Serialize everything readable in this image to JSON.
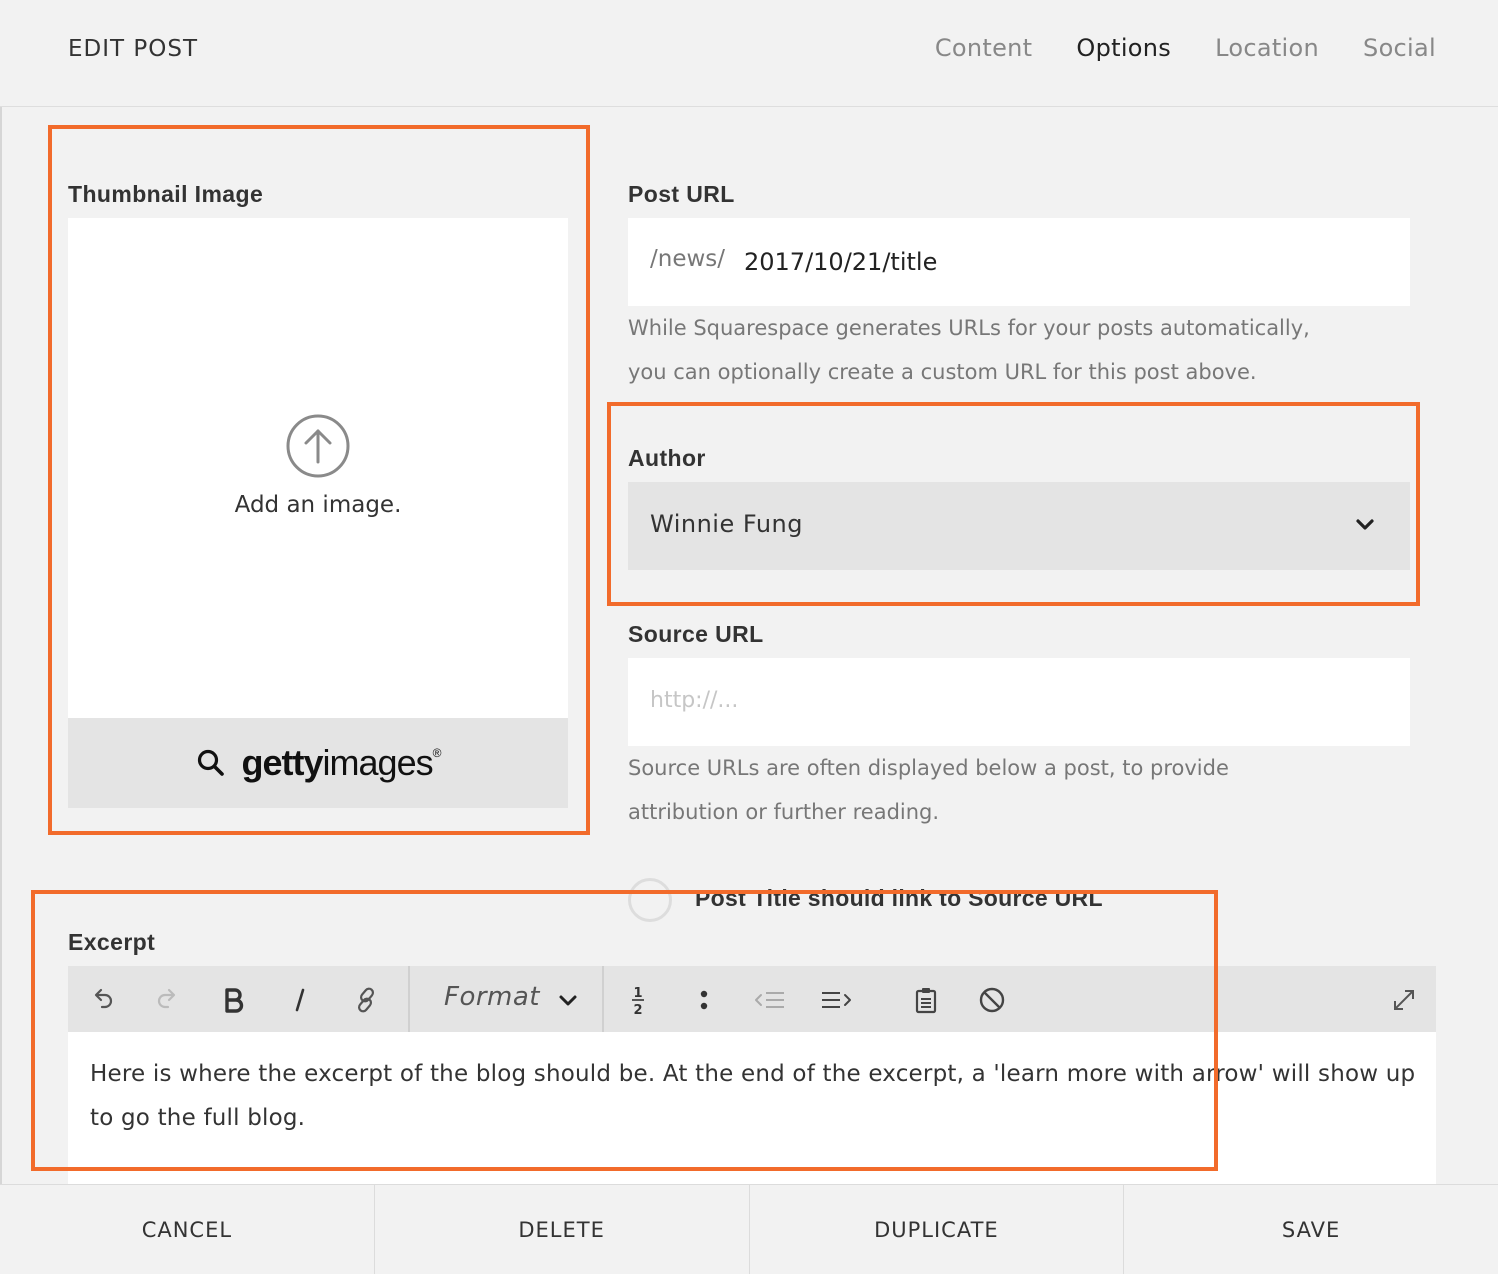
{
  "header": {
    "title": "EDIT POST",
    "tabs": [
      {
        "label": "Content"
      },
      {
        "label": "Options"
      },
      {
        "label": "Location"
      },
      {
        "label": "Social"
      }
    ],
    "active_tab": "Options"
  },
  "thumbnail": {
    "label": "Thumbnail Image",
    "add_text": "Add an image.",
    "getty_brand_bold": "getty",
    "getty_brand_regular": "images",
    "getty_reg_mark": "®"
  },
  "post_url": {
    "label": "Post URL",
    "prefix": "/news/",
    "value": "2017/10/21/title",
    "help_line1": "While Squarespace generates URLs for your posts automatically,",
    "help_line2": "you can optionally create a custom URL for this post above."
  },
  "author": {
    "label": "Author",
    "selected": "Winnie Fung"
  },
  "source_url": {
    "label": "Source URL",
    "placeholder": "http://...",
    "value": "",
    "help_line1": "Source URLs are often displayed below a post, to provide",
    "help_line2": "attribution or further reading."
  },
  "title_link": {
    "label": "Post Title should link to Source URL",
    "checked": false
  },
  "excerpt": {
    "label": "Excerpt",
    "format_label": "Format",
    "list_number_top": "1",
    "list_number_bottom": "2",
    "text": "Here is where the excerpt of the blog should be.  At the end of the excerpt, a 'learn more with arrow' will show up to go the full blog."
  },
  "footer": {
    "cancel": "CANCEL",
    "delete": "DELETE",
    "duplicate": "DUPLICATE",
    "save": "SAVE"
  },
  "colors": {
    "highlight": "#f26b2b",
    "background": "#f2f2f2",
    "field_bg": "#ffffff",
    "select_bg": "#e4e4e4"
  }
}
